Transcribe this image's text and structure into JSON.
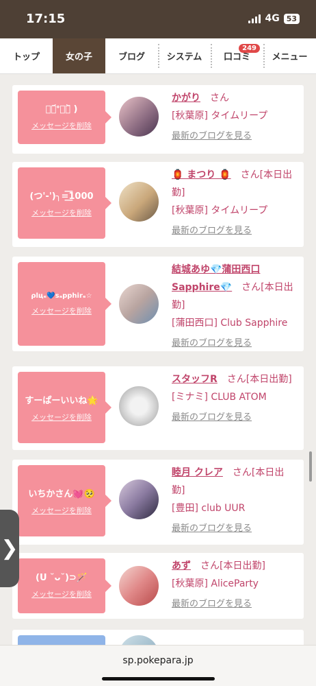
{
  "status": {
    "time": "17:15",
    "network": "4G",
    "battery": "53"
  },
  "tabs": [
    {
      "label": "トップ"
    },
    {
      "label": "女の子"
    },
    {
      "label": "ブログ"
    },
    {
      "label": "システム"
    },
    {
      "label": "口コミ",
      "badge": "249"
    },
    {
      "label": "メニュー"
    }
  ],
  "messages": [
    {
      "bubble": "ดู᷄ᐤดู᷅ )",
      "delete_label": "メッセージを削除",
      "name": "かがり",
      "honorific": "さん",
      "status": "",
      "shop": "[秋葉原] タイムリープ",
      "blog_link": "最新のブログを見る"
    },
    {
      "bubble": "(つ'-')╮=͟͟͞͞1000",
      "delete_label": "メッセージを削除",
      "name": "🏮 まつり 🏮",
      "honorific": "さん",
      "status": "[本日出勤]",
      "shop": "[秋葉原] タイムリープ",
      "blog_link": "最新のブログを見る"
    },
    {
      "bubble": "ρlцₑ💙sₐpphirₑ☆",
      "delete_label": "メッセージを削除",
      "name": "結城あゆ💎蒲田西口Sapphire💎",
      "honorific": "さん",
      "status": "[本日出勤]",
      "shop": "[蒲田西口] Club Sapphire",
      "blog_link": "最新のブログを見る"
    },
    {
      "bubble": "すーぱーいいね🌟",
      "delete_label": "メッセージを削除",
      "name": "スタッフR",
      "honorific": "さん",
      "status": "[本日出勤]",
      "shop": "[ミナミ] CLUB ATOM",
      "blog_link": "最新のブログを見る"
    },
    {
      "bubble": "いちかさん💓🥺",
      "delete_label": "メッセージを削除",
      "name": "睦月 クレア",
      "honorific": "さん",
      "status": "[本日出勤]",
      "shop": "[豊田] club UUR",
      "blog_link": "最新のブログを見る"
    },
    {
      "bubble": "(U ˘ᴗ˘)⊃🪄",
      "delete_label": "メッセージを削除",
      "name": "あず",
      "honorific": "さん",
      "status": "[本日出勤]",
      "shop": "[秋葉原] AliceParty",
      "blog_link": "最新のブログを見る"
    }
  ],
  "side_tab": "❯",
  "url": "sp.pokepara.jp"
}
